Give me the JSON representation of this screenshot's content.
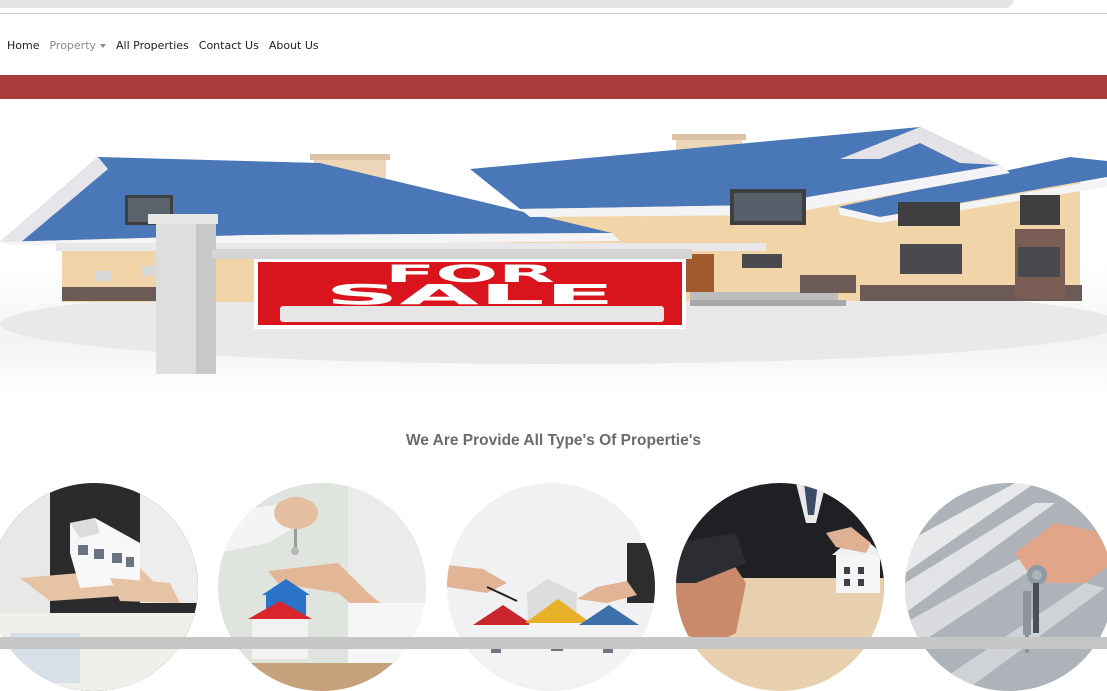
{
  "nav": {
    "items": [
      {
        "label": "Home"
      },
      {
        "label": "Property",
        "muted": true,
        "has_dropdown": true
      },
      {
        "label": "All Properties"
      },
      {
        "label": "Contact Us"
      },
      {
        "label": "About Us"
      }
    ]
  },
  "hero": {
    "sign_line1": "FOR",
    "sign_line2": "SALE"
  },
  "section": {
    "title": "We Are Provide All Type's Of Propertie's"
  },
  "colors": {
    "band": "#a83c3c",
    "roof": "#4a77b8",
    "wall": "#f1d4a8",
    "sign": "#d9141c"
  }
}
